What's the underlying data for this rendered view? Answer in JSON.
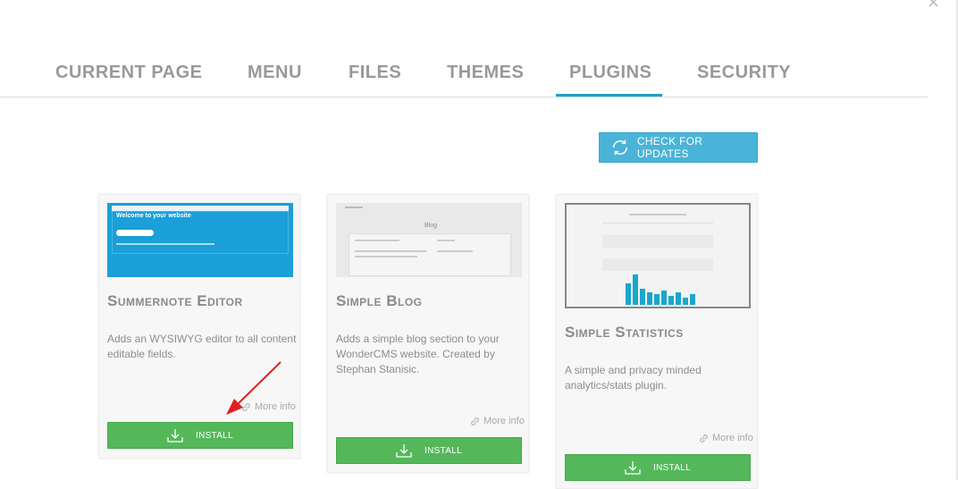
{
  "window": {
    "close_glyph": "×"
  },
  "tabs": [
    {
      "label": "CURRENT PAGE",
      "active": false
    },
    {
      "label": "MENU",
      "active": false
    },
    {
      "label": "FILES",
      "active": false
    },
    {
      "label": "THEMES",
      "active": false
    },
    {
      "label": "PLUGINS",
      "active": true
    },
    {
      "label": "SECURITY",
      "active": false
    }
  ],
  "toolbar": {
    "check_updates_label": "CHECK FOR UPDATES",
    "icon": "refresh-icon"
  },
  "plugins": [
    {
      "title": "Summernote Editor",
      "description": "Adds an WYSIWYG editor to all content editable fields.",
      "more_info_label": "More info",
      "install_label": "INSTALL",
      "thumbnail": {
        "heading": "Welcome to your website"
      }
    },
    {
      "title": "Simple Blog",
      "description": "Adds a simple blog section to your WonderCMS website. Created by Stephan Stanisic.",
      "more_info_label": "More info",
      "install_label": "INSTALL",
      "thumbnail": {
        "heading": "Blog"
      }
    },
    {
      "title": "Simple Statistics",
      "description": "A simple and privacy minded analytics/stats plugin.",
      "more_info_label": "More info",
      "install_label": "INSTALL"
    }
  ],
  "colors": {
    "accent": "#1ea0c8",
    "update_button": "#4ab4d8",
    "install_button": "#54b85a",
    "annotation_arrow": "#e02020"
  }
}
